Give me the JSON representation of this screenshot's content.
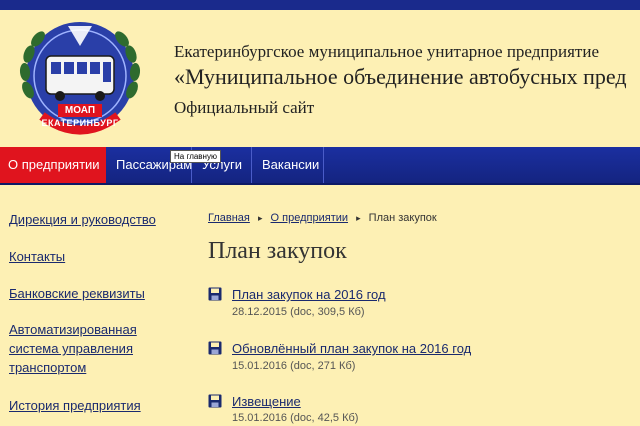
{
  "header": {
    "logo_top_text": "МОАП",
    "logo_bottom_text": "ЕКАТЕРИНБУРГ",
    "org_line1": "Екатеринбургское муниципальное унитарное предприятие",
    "org_line2": "«Муниципальное объединение автобусных пред",
    "org_line3": "Официальный сайт"
  },
  "nav": {
    "items": [
      {
        "label": "О предприятии"
      },
      {
        "label": "Пассажирам"
      },
      {
        "label": "Услуги"
      },
      {
        "label": "Вакансии"
      }
    ],
    "tooltip": "На главную"
  },
  "sidebar": {
    "items": [
      {
        "label": "Дирекция и руководство"
      },
      {
        "label": "Контакты"
      },
      {
        "label": "Банковские реквизиты"
      },
      {
        "label": "Автоматизированная система управления транспортом"
      },
      {
        "label": "История предприятия"
      }
    ]
  },
  "breadcrumb": {
    "items": [
      "Главная",
      "О предприятии",
      "План закупок"
    ]
  },
  "main": {
    "title": "План закупок",
    "documents": [
      {
        "title": "План закупок на 2016 год",
        "meta": "28.12.2015 (doc, 309,5 Кб)"
      },
      {
        "title": "Обновлённый план закупок на 2016 год",
        "meta": "15.01.2016 (doc, 271 Кб)"
      },
      {
        "title": "Извещение",
        "meta": "15.01.2016 (doc, 42,5 Кб)"
      }
    ]
  },
  "colors": {
    "background": "#fdf0b4",
    "nav_blue": "#1b2fa0",
    "active_red": "#e0141e",
    "link": "#1a2a6e"
  }
}
